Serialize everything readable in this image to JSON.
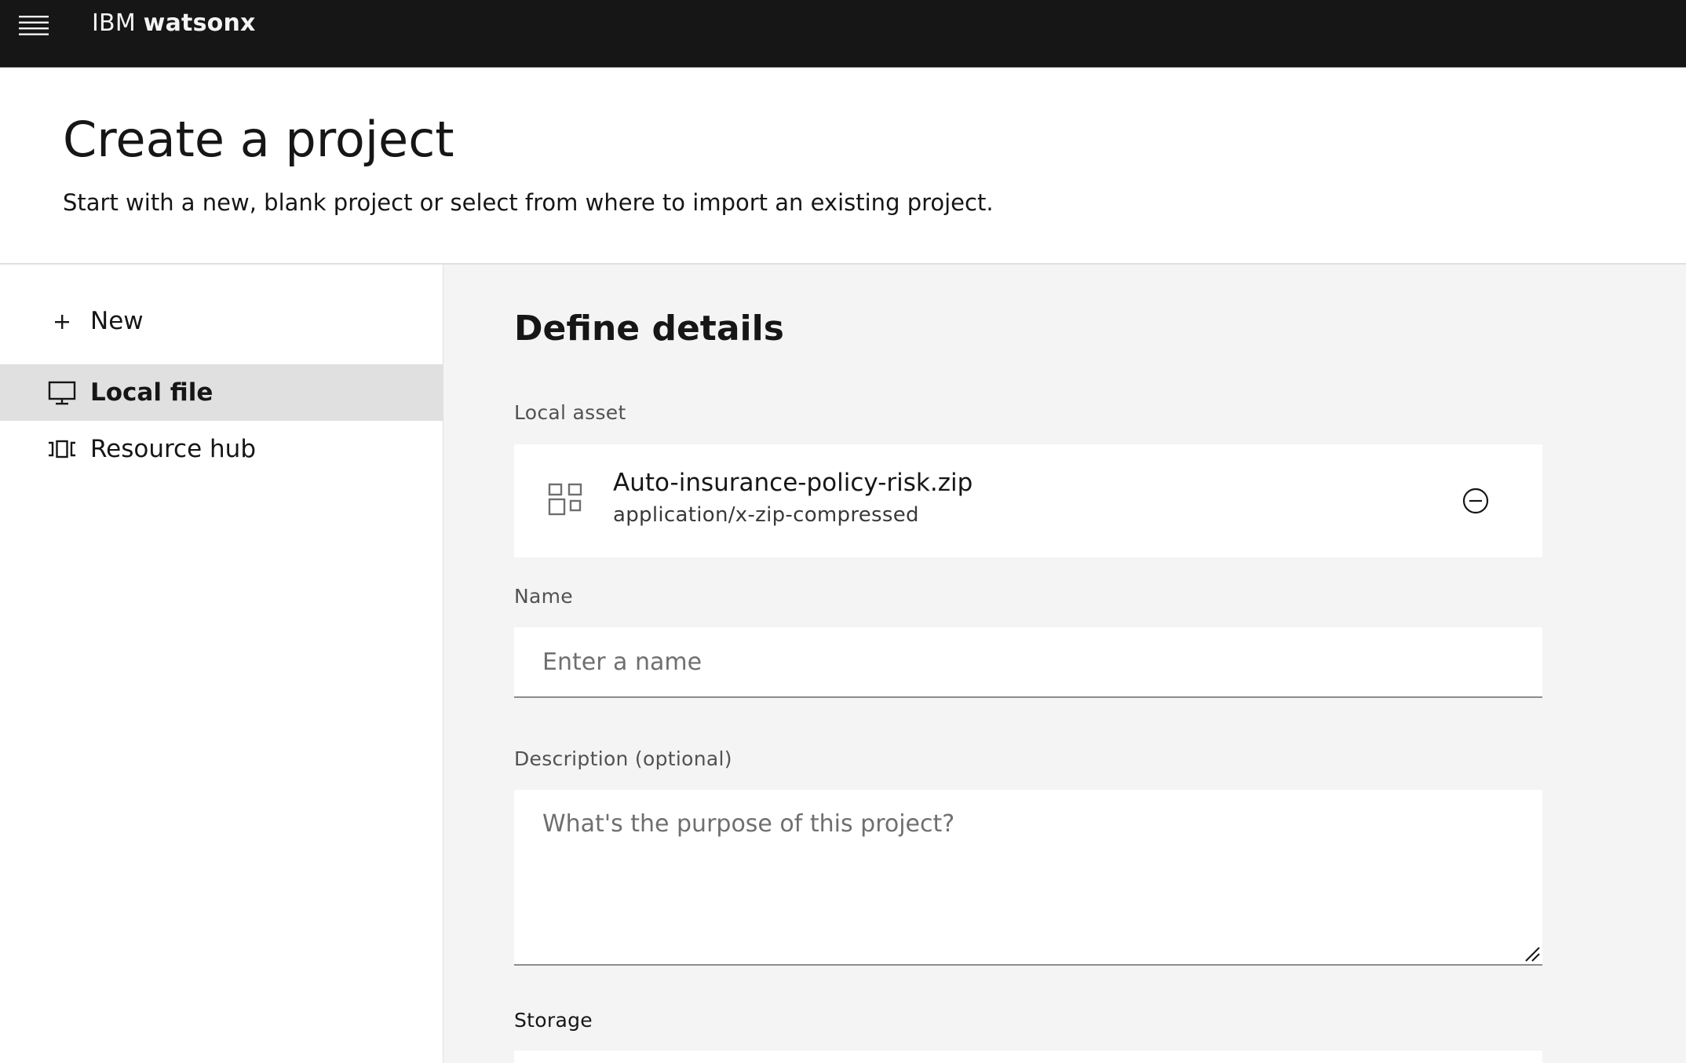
{
  "header": {
    "brand_prefix": "IBM",
    "brand_product": "watsonx",
    "menu_icon": "hamburger-menu-icon"
  },
  "page": {
    "title": "Create a project",
    "subtitle": "Start with a new, blank project or select from where to import an existing project."
  },
  "sidenav": {
    "items": [
      {
        "label": "New",
        "icon": "plus-icon",
        "active": false
      },
      {
        "label": "Local file",
        "icon": "desktop-monitor-icon",
        "active": true
      },
      {
        "label": "Resource hub",
        "icon": "carousel-icon",
        "active": false
      }
    ]
  },
  "main": {
    "section_title": "Define details",
    "local_asset": {
      "label": "Local asset",
      "file_name": "Auto-insurance-policy-risk.zip",
      "file_type": "application/x-zip-compressed",
      "icon": "asset-grid-icon",
      "remove_icon": "remove-circle-icon"
    },
    "name_field": {
      "label": "Name",
      "placeholder": "Enter a name",
      "value": ""
    },
    "description_field": {
      "label": "Description (optional)",
      "placeholder": "What's the purpose of this project?",
      "value": ""
    },
    "storage": {
      "label": "Storage"
    }
  },
  "colors": {
    "header_bg": "#161616",
    "nav_active_bg": "#e0e0e0",
    "main_bg": "#f4f4f4",
    "field_bg": "#ffffff",
    "text_primary": "#161616",
    "text_secondary": "#525252"
  }
}
